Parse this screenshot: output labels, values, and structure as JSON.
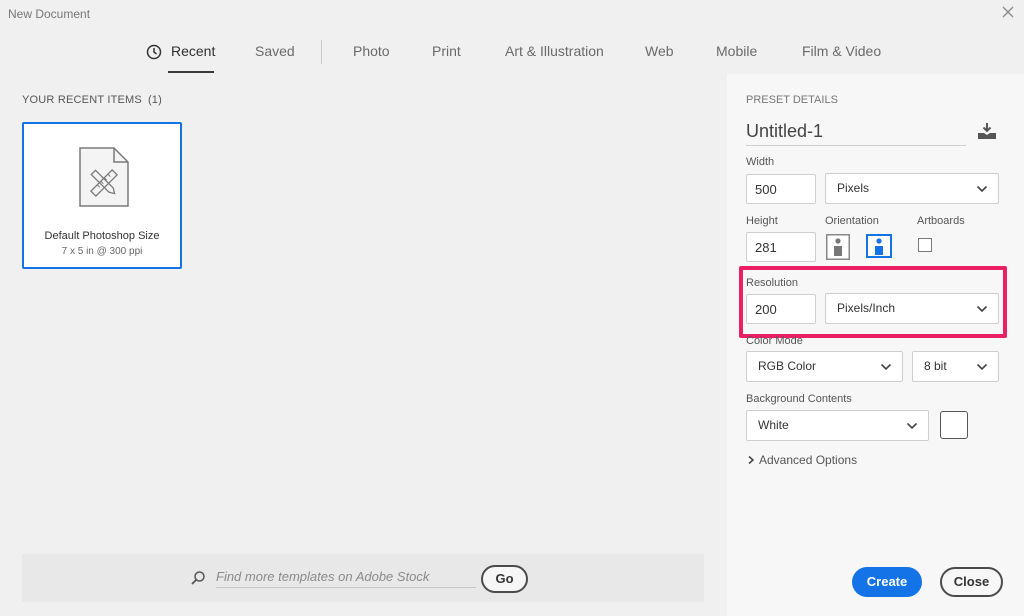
{
  "window": {
    "title": "New Document"
  },
  "tabs": [
    {
      "label": "Recent",
      "active": true
    },
    {
      "label": "Saved"
    },
    {
      "label": "Photo"
    },
    {
      "label": "Print"
    },
    {
      "label": "Art & Illustration"
    },
    {
      "label": "Web"
    },
    {
      "label": "Mobile"
    },
    {
      "label": "Film & Video"
    }
  ],
  "recent": {
    "header": "YOUR RECENT ITEMS",
    "count": "(1)",
    "items": [
      {
        "title": "Default Photoshop Size",
        "subtitle": "7 x 5 in @ 300 ppi"
      }
    ]
  },
  "stock": {
    "placeholder": "Find more templates on Adobe Stock",
    "go_label": "Go"
  },
  "preset": {
    "section_label": "PRESET DETAILS",
    "name": "Untitled-1",
    "width_label": "Width",
    "width_value": "500",
    "width_unit": "Pixels",
    "height_label": "Height",
    "height_value": "281",
    "orientation_label": "Orientation",
    "orientation_selected": "landscape",
    "artboards_label": "Artboards",
    "artboards_checked": false,
    "resolution_label": "Resolution",
    "resolution_value": "200",
    "resolution_unit": "Pixels/Inch",
    "color_mode_label": "Color Mode",
    "color_mode": "RGB Color",
    "bit_depth": "8 bit",
    "background_label": "Background Contents",
    "background": "White",
    "background_swatch": "#ffffff",
    "advanced_label": "Advanced Options"
  },
  "buttons": {
    "create": "Create",
    "close": "Close"
  },
  "colors": {
    "accent": "#1473e6",
    "highlight": "#ea1f64"
  }
}
